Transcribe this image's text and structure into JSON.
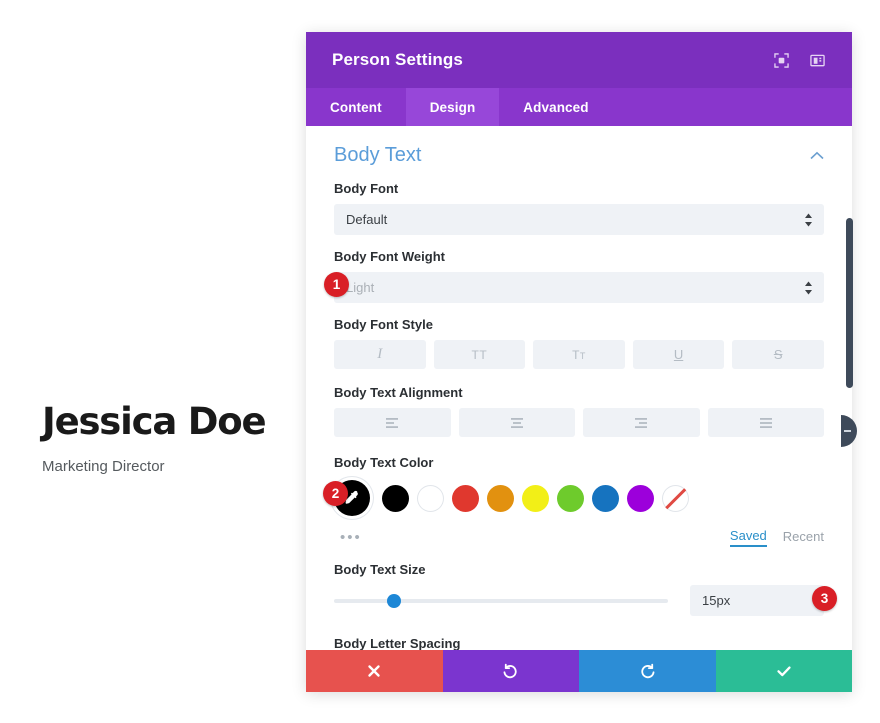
{
  "preview": {
    "name": "Jessica Doe",
    "role": "Marketing Director"
  },
  "panel": {
    "title": "Person Settings",
    "header_icons": [
      {
        "name": "focus-icon",
        "label": "Focus"
      },
      {
        "name": "layout-icon",
        "label": "Layout"
      }
    ],
    "tabs": [
      {
        "label": "Content",
        "active": false
      },
      {
        "label": "Design",
        "active": true
      },
      {
        "label": "Advanced",
        "active": false
      }
    ],
    "section": {
      "title": "Body Text",
      "collapse_icon": "chevron-up-icon"
    },
    "fields": {
      "body_font": {
        "label": "Body Font",
        "value": "Default",
        "placeholder": "Default"
      },
      "body_font_weight": {
        "label": "Body Font Weight",
        "value": "Light",
        "placeholder": "Light"
      },
      "body_font_style": {
        "label": "Body Font Style",
        "options": [
          {
            "name": "italic",
            "glyph": "I"
          },
          {
            "name": "uppercase",
            "glyph": "TT"
          },
          {
            "name": "small-caps",
            "glyph": "T"
          },
          {
            "name": "underline",
            "glyph": "U"
          },
          {
            "name": "strikethrough",
            "glyph": "S"
          }
        ]
      },
      "body_text_alignment": {
        "label": "Body Text Alignment",
        "options": [
          {
            "name": "align-left"
          },
          {
            "name": "align-center"
          },
          {
            "name": "align-right"
          },
          {
            "name": "align-justify"
          }
        ]
      },
      "body_text_color": {
        "label": "Body Text Color",
        "selected_color": "#000000",
        "picker_icon": "eyedropper-icon",
        "swatches": [
          {
            "name": "black",
            "hex": "#000000"
          },
          {
            "name": "white",
            "hex": "#ffffff"
          },
          {
            "name": "red",
            "hex": "#e0382e"
          },
          {
            "name": "orange",
            "hex": "#e2910f"
          },
          {
            "name": "yellow",
            "hex": "#f2ef17"
          },
          {
            "name": "green",
            "hex": "#6ecb2c"
          },
          {
            "name": "blue",
            "hex": "#1673bf"
          },
          {
            "name": "purple",
            "hex": "#9c00db"
          },
          {
            "name": "transparent",
            "hex": "transparent"
          }
        ],
        "more_label": "•••",
        "foot_tabs": [
          {
            "label": "Saved",
            "active": true
          },
          {
            "label": "Recent",
            "active": false
          }
        ]
      },
      "body_text_size": {
        "label": "Body Text Size",
        "value": "15px",
        "slider_percent": 17
      },
      "body_letter_spacing": {
        "label": "Body Letter Spacing"
      }
    },
    "actions": [
      {
        "name": "cancel-button",
        "icon": "close-icon",
        "color": "#e7524e"
      },
      {
        "name": "undo-button",
        "icon": "undo-icon",
        "color": "#7b35cf"
      },
      {
        "name": "redo-button",
        "icon": "redo-icon",
        "color": "#2c8dd6"
      },
      {
        "name": "save-button",
        "icon": "check-icon",
        "color": "#2bbd96"
      }
    ]
  },
  "badges": [
    {
      "label": "1"
    },
    {
      "label": "2"
    },
    {
      "label": "3"
    }
  ]
}
